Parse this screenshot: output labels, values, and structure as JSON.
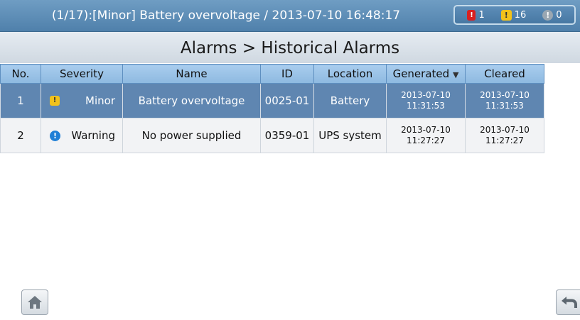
{
  "status_bar": {
    "alarm_text": "(1/17):[Minor] Battery overvoltage / 2013-07-10 16:48:17",
    "counts": {
      "critical": "1",
      "minor": "16",
      "warning": "0"
    }
  },
  "title": "Alarms > Historical Alarms",
  "table": {
    "headers": {
      "no": "No.",
      "severity": "Severity",
      "name": "Name",
      "id": "ID",
      "location": "Location",
      "generated": "Generated",
      "cleared": "Cleared"
    },
    "sorted_by": "generated",
    "rows": [
      {
        "no": "1",
        "severity": "Minor",
        "severity_icon": "minor-alarm-icon",
        "name": "Battery overvoltage",
        "id": "0025-01",
        "location": "Battery",
        "generated_date": "2013-07-10",
        "generated_time": "11:31:53",
        "cleared_date": "2013-07-10",
        "cleared_time": "11:31:53",
        "selected": true
      },
      {
        "no": "2",
        "severity": "Warning",
        "severity_icon": "warning-info-icon",
        "name": "No power supplied",
        "id": "0359-01",
        "location": "UPS system",
        "generated_date": "2013-07-10",
        "generated_time": "11:27:27",
        "cleared_date": "2013-07-10",
        "cleared_time": "11:27:27",
        "selected": false
      }
    ]
  },
  "buttons": {
    "home_icon": "home-icon",
    "back_icon": "back-arrow-icon"
  },
  "colors": {
    "header_bar": "#5a89b4",
    "selected_row": "#5f86b1",
    "column_header": "#9fc6ea",
    "minor": "#f2c21a",
    "warning": "#1f7fd6",
    "critical": "#d92020"
  }
}
